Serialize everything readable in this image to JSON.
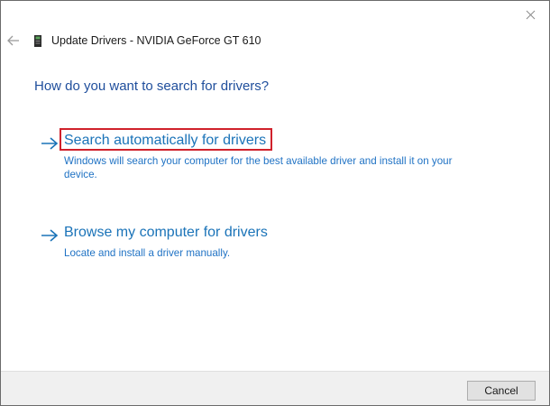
{
  "window": {
    "title": "Update Drivers - NVIDIA GeForce GT 610"
  },
  "controls": {
    "close_icon": "close-icon",
    "back_icon": "back-arrow-icon",
    "device_icon": "graphics-card-icon"
  },
  "main": {
    "heading": "How do you want to search for drivers?",
    "options": [
      {
        "title": "Search automatically for drivers",
        "description": "Windows will search your computer for the best available driver and install it on your device.",
        "highlighted": true,
        "icon": "arrow-right-icon"
      },
      {
        "title": "Browse my computer for drivers",
        "description": "Locate and install a driver manually.",
        "highlighted": false,
        "icon": "arrow-right-icon"
      }
    ]
  },
  "footer": {
    "cancel_label": "Cancel"
  },
  "colors": {
    "heading": "#1f4e9c",
    "link": "#1a73b8",
    "description": "#1f72c4",
    "highlight_border": "#d0212b",
    "footer_bg": "#f0f0f0"
  }
}
